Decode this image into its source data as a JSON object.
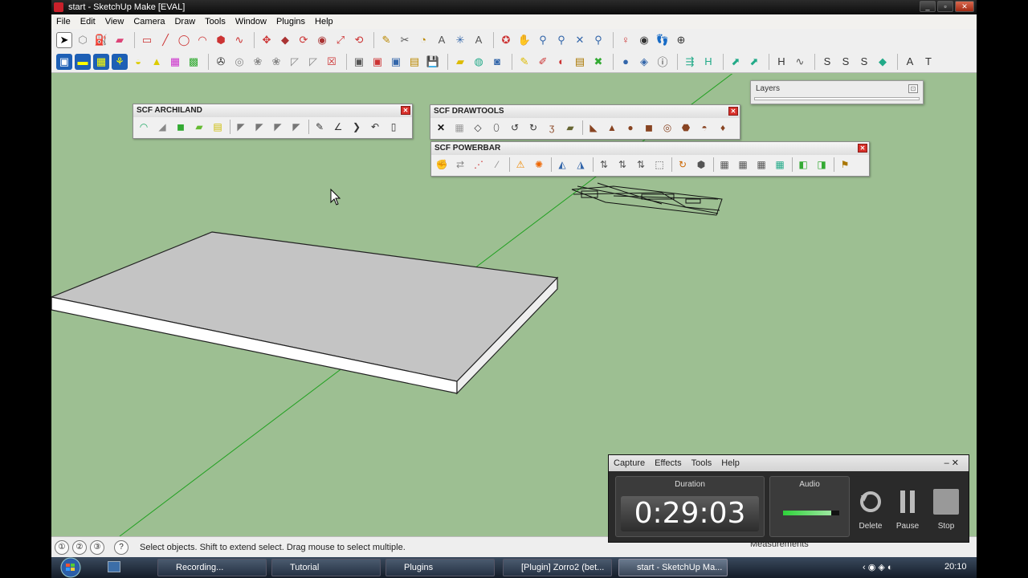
{
  "window": {
    "title": "start - SketchUp Make [EVAL]",
    "controls": [
      "_",
      "▫",
      "✕"
    ]
  },
  "menu": [
    "File",
    "Edit",
    "View",
    "Camera",
    "Draw",
    "Tools",
    "Window",
    "Plugins",
    "Help"
  ],
  "palettes": {
    "archiland": {
      "title": "SCF ARCHILAND",
      "close": "✕"
    },
    "drawtools": {
      "title": "SCF DRAWTOOLS",
      "close": "✕"
    },
    "powerbar": {
      "title": "SCF POWERBAR",
      "close": "✕"
    }
  },
  "layers": {
    "title": "Layers",
    "close": "⊡"
  },
  "status": {
    "text": "Select objects. Shift to extend select. Drag mouse to select multiple.",
    "measurements_label": "Measurements",
    "icons": [
      "①",
      "②",
      "③",
      "?"
    ]
  },
  "recorder": {
    "menu": [
      "Capture",
      "Effects",
      "Tools",
      "Help"
    ],
    "controls": "–  ✕",
    "duration_label": "Duration",
    "duration": "0:29:03",
    "audio_label": "Audio",
    "audio_level": 0.85,
    "buttons": {
      "delete": "Delete",
      "pause": "Pause",
      "stop": "Stop"
    }
  },
  "taskbar": {
    "items": [
      "Recording...",
      "Tutorial",
      "Plugins",
      "[Plugin] Zorro2 (bet...",
      "start - SketchUp Ma..."
    ],
    "clock": "20:10"
  },
  "colors": {
    "canvas": "#9dbf92",
    "box_top": "#c4c4c4",
    "axis_green": "#20a020",
    "close_red": "#d8302a"
  }
}
